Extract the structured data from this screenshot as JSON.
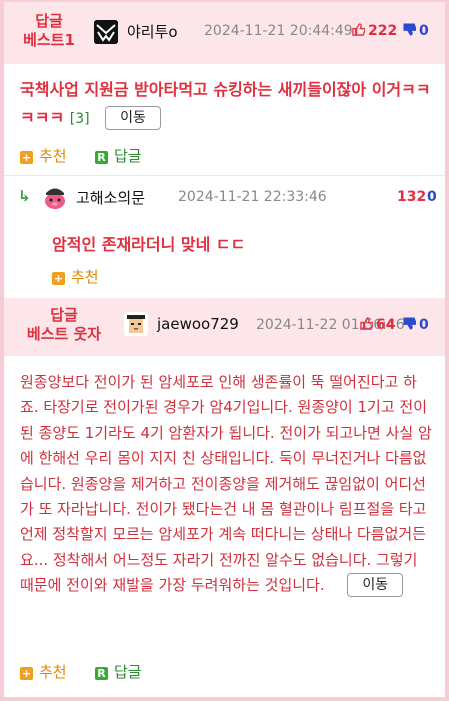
{
  "best1": {
    "badge_line1": "답글",
    "badge_line2": "베스트1",
    "nickname": "야리투o",
    "date": "2024-11-21 20:44:49",
    "up_count": "222",
    "down_count": "0",
    "title": "국책사업 지원금 받아타먹고 슈킹하는 새끼들이잖아 이거ㅋㅋㅋㅋㅋ",
    "comment_count": "[3]",
    "move_label": "이동",
    "recommend_label": "추천",
    "reply_label": "답글"
  },
  "reply1": {
    "nickname": "고해소의문",
    "date": "2024-11-21 22:33:46",
    "up_count": "132",
    "down_count": "0",
    "body": "암적인 존재라더니 맞네 ㄷㄷ",
    "recommend_label": "추천"
  },
  "best2": {
    "badge_line1": "답글",
    "badge_line2": "베스트 웃자",
    "nickname": "jaewoo729",
    "date": "2024-11-22 01:56:46",
    "up_count": "64",
    "down_count": "0",
    "body": "원종양보다 전이가 된 암세포로 인해 생존률이 뚝 떨어진다고 하죠. 타장기로 전이가된 경우가 암4기입니다. 원종양이 1기고 전이된 종양도 1기라도 4기 암환자가 됩니다. 전이가 되고나면 사실 암에 한해선 우리 몸이 지지 친 상태입니다. 둑이 무너진거나 다름없습니다. 원종양을 제거하고 전이종양을 제거해도 끊임없이 어디선가 또 자라납니다. 전이가 됐다는건 내 몸 혈관이나 림프절을 타고 언제 정착할지 모르는 암세포가 계속 떠다니는 상태나 다름없거든요... 정착해서 어느정도 자라기 전까진 알수도 없습니다. 그렇기 때문에 전이와 재발을 가장 두려워하는 것입니다.",
    "move_label": "이동",
    "recommend_label": "추천",
    "reply_label": "답글"
  },
  "colors": {
    "accent_red": "#e0303f",
    "accent_blue": "#2a4bd0",
    "header_bg": "#fce6ea",
    "reply_green": "#2e8b2e",
    "recommend_orange": "#e08a00"
  }
}
